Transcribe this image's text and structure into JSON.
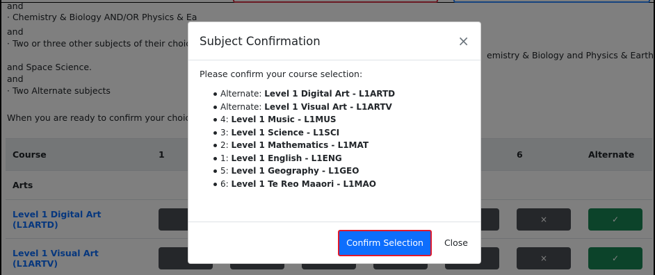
{
  "background": {
    "lines": [
      "and",
      "· Chemistry & Biology AND/OR Physics & Ea",
      "and",
      "· Two or three other subjects of their choice",
      "emistry & Biology and Physics & Earth",
      "and Space Science.",
      "and",
      "· Two Alternate subjects",
      "When you are ready to confirm your choice"
    ],
    "table": {
      "headers": [
        "Course",
        "1",
        "",
        "",
        "",
        "",
        "6",
        "Alternate"
      ],
      "group": "Arts",
      "rows": [
        {
          "course": "Level 1 Digital Art (L1ARTD)",
          "x_mark": "×",
          "check_mark": "✓"
        },
        {
          "course": "Level 1 Visual Art (L1ARTV)",
          "x_mark": "×",
          "check_mark": "✓"
        }
      ]
    }
  },
  "modal": {
    "title": "Subject Confirmation",
    "close_icon": "×",
    "intro": "Please confirm your course selection:",
    "items": [
      {
        "prefix": "Alternate: ",
        "name": "Level 1 Digital Art - L1ARTD"
      },
      {
        "prefix": "Alternate: ",
        "name": "Level 1 Visual Art - L1ARTV"
      },
      {
        "prefix": "4: ",
        "name": "Level 1 Music - L1MUS"
      },
      {
        "prefix": "3: ",
        "name": "Level 1 Science - L1SCI"
      },
      {
        "prefix": "2: ",
        "name": "Level 1 Mathematics - L1MAT"
      },
      {
        "prefix": "1: ",
        "name": "Level 1 English - L1ENG"
      },
      {
        "prefix": "5: ",
        "name": "Level 1 Geography - L1GEO"
      },
      {
        "prefix": "6: ",
        "name": "Level 1 Te Reo Maaori - L1MAO"
      }
    ],
    "confirm_label": "Confirm Selection",
    "close_label": "Close"
  },
  "colors": {
    "primary": "#0d6efd",
    "success": "#198754",
    "dark_button": "#4a4f55",
    "highlight_red": "#e0182b"
  }
}
